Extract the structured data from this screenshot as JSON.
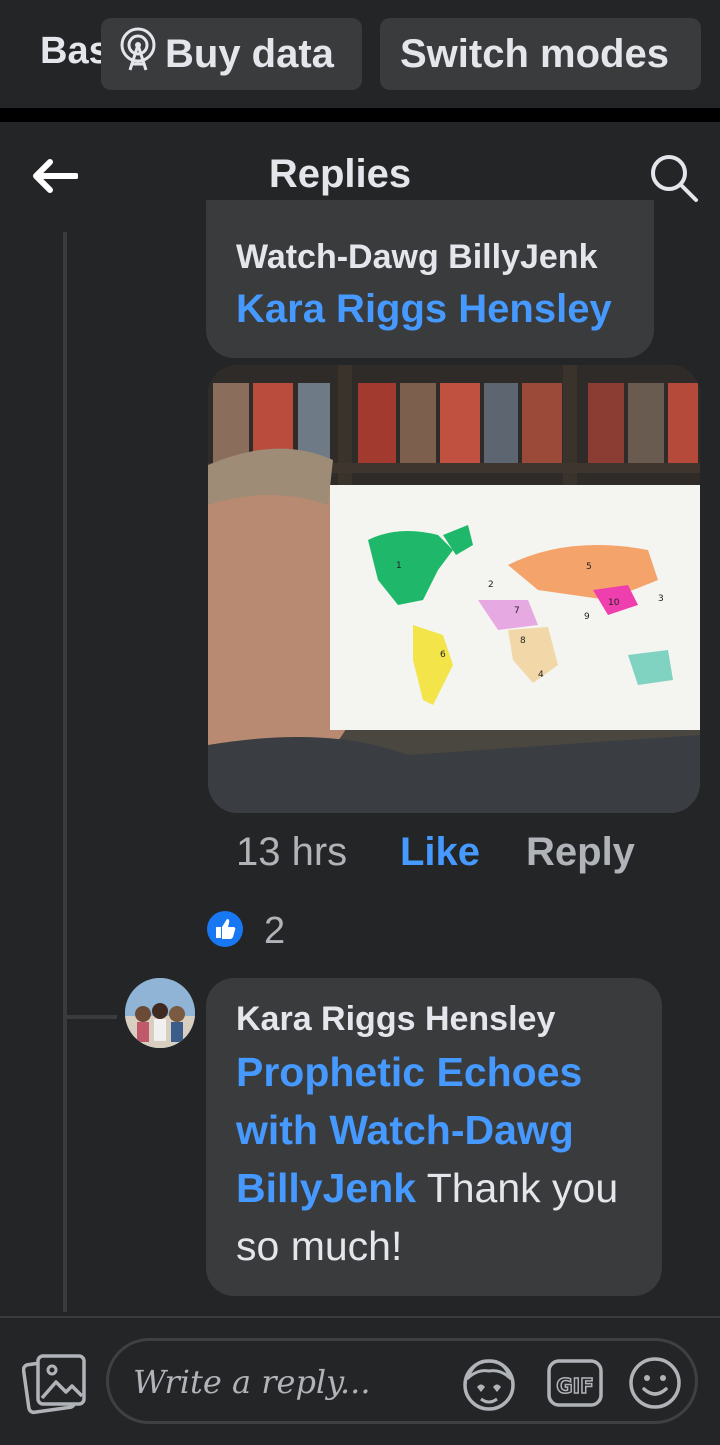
{
  "banner": {
    "cut_label": "Basic",
    "buy_data_label": "Buy data",
    "switch_modes_label": "Switch modes"
  },
  "topbar": {
    "title": "Replies"
  },
  "comment1": {
    "author_partial": "Watch-Dawg BillyJenk",
    "mention": "Kara Riggs Hensley",
    "photo_alt": "Man holding a world map",
    "time": "13 hrs",
    "like_label": "Like",
    "reply_label": "Reply",
    "reaction_count": "2"
  },
  "map_labels": [
    "1",
    "2",
    "3",
    "4",
    "5",
    "6",
    "7",
    "8",
    "9",
    "10"
  ],
  "comment2": {
    "author": "Kara Riggs Hensley",
    "mention": "Prophetic Echoes with Watch-Dawg BillyJenk",
    "text": " Thank you so much!"
  },
  "composer": {
    "placeholder": "Write a reply..."
  },
  "colors": {
    "background": "#242526",
    "bubble": "#3a3b3c",
    "link": "#4599ff",
    "like_badge": "#1877f2"
  }
}
